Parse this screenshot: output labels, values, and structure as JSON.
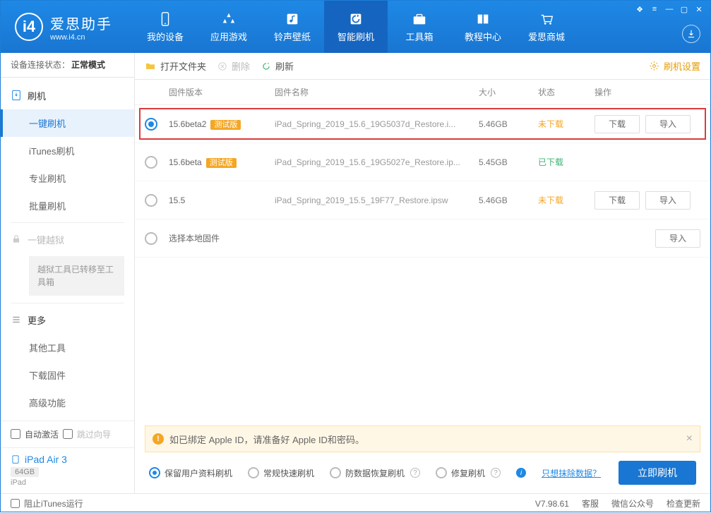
{
  "app": {
    "title": "爱思助手",
    "subtitle": "www.i4.cn"
  },
  "nav": {
    "items": [
      {
        "label": "我的设备"
      },
      {
        "label": "应用游戏"
      },
      {
        "label": "铃声壁纸"
      },
      {
        "label": "智能刷机"
      },
      {
        "label": "工具箱"
      },
      {
        "label": "教程中心"
      },
      {
        "label": "爱思商城"
      }
    ]
  },
  "sidebar": {
    "status_label": "设备连接状态：",
    "status_value": "正常模式",
    "flash_head": "刷机",
    "items": [
      "一键刷机",
      "iTunes刷机",
      "专业刷机",
      "批量刷机"
    ],
    "jailbreak": "一键越狱",
    "jailbreak_note": "越狱工具已转移至工具箱",
    "more_head": "更多",
    "more_items": [
      "其他工具",
      "下载固件",
      "高级功能"
    ],
    "auto_activate": "自动激活",
    "skip_guide": "跳过向导"
  },
  "device": {
    "name": "iPad Air 3",
    "capacity": "64GB",
    "type": "iPad"
  },
  "toolbar": {
    "open_folder": "打开文件夹",
    "delete": "删除",
    "refresh": "刷新",
    "settings": "刷机设置"
  },
  "table": {
    "cols": {
      "version": "固件版本",
      "name": "固件名称",
      "size": "大小",
      "status": "状态",
      "ops": "操作"
    },
    "rows": [
      {
        "selected": true,
        "version": "15.6beta2",
        "beta": "测试版",
        "name": "iPad_Spring_2019_15.6_19G5037d_Restore.i...",
        "size": "5.46GB",
        "status": "未下载",
        "status_class": "nd",
        "highlight": true,
        "ops_dl": true,
        "ops_imp": true
      },
      {
        "selected": false,
        "version": "15.6beta",
        "beta": "测试版",
        "name": "iPad_Spring_2019_15.6_19G5027e_Restore.ip...",
        "size": "5.45GB",
        "status": "已下载",
        "status_class": "dl",
        "highlight": false,
        "ops_dl": false,
        "ops_imp": false
      },
      {
        "selected": false,
        "version": "15.5",
        "beta": "",
        "name": "iPad_Spring_2019_15.5_19F77_Restore.ipsw",
        "size": "5.46GB",
        "status": "未下载",
        "status_class": "nd",
        "highlight": false,
        "ops_dl": true,
        "ops_imp": true
      }
    ],
    "local_row": "选择本地固件",
    "btn_download": "下载",
    "btn_import": "导入"
  },
  "alert": {
    "text": "如已绑定 Apple ID，请准备好 Apple ID和密码。"
  },
  "flash_options": {
    "opts": [
      "保留用户资料刷机",
      "常规快速刷机",
      "防数据恢复刷机",
      "修复刷机"
    ],
    "erase_link": "只想抹除数据？",
    "flash_btn": "立即刷机"
  },
  "footer": {
    "block_itunes": "阻止iTunes运行",
    "version": "V7.98.61",
    "items": [
      "客服",
      "微信公众号",
      "检查更新"
    ]
  }
}
